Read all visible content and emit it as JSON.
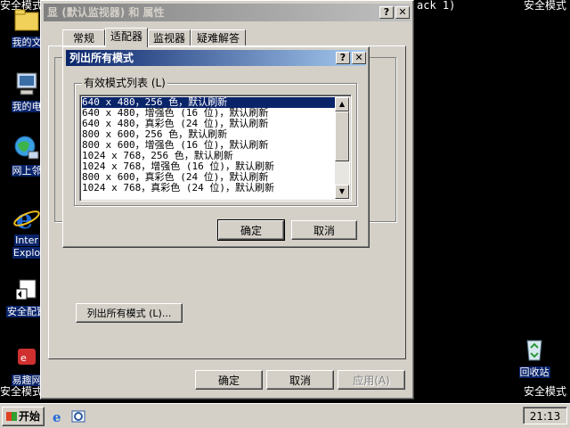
{
  "desktop": {
    "safe_mode_label": "安全模式",
    "service_pack_text": "ack 1)",
    "icons": [
      {
        "label": "我的文"
      },
      {
        "label": "我的电"
      },
      {
        "label": "网上邻"
      },
      {
        "label": "Inter",
        "label2": "Explo"
      },
      {
        "label": "安全配置"
      },
      {
        "label": "易趣网"
      },
      {
        "label": "回收站"
      }
    ]
  },
  "props_window": {
    "title": "(默认监视器) 和   属性",
    "title_prefix": "显",
    "help_button": "?",
    "close_button": "✕",
    "tabs": [
      "常规",
      "适配器",
      "监视器",
      "疑难解答"
    ],
    "active_tab": "适配器",
    "list_all_modes_button": "列出所有模式 (L)...",
    "ok_button": "确定",
    "cancel_button": "取消",
    "apply_button": "应用(A)"
  },
  "list_dialog": {
    "title": "列出所有模式",
    "help_button": "?",
    "close_button": "✕",
    "group_label": "有效模式列表 (L)",
    "modes": [
      "640 x 480，256 色，默认刷新",
      "640 x 480，增强色 (16 位)，默认刷新",
      "640 x 480，真彩色 (24 位)，默认刷新",
      "800 x 600，256 色，默认刷新",
      "800 x 600，增强色 (16 位)，默认刷新",
      "1024 x 768，256 色，默认刷新",
      "1024 x 768，增强色 (16 位)，默认刷新",
      "800 x 600，真彩色 (24 位)，默认刷新",
      "1024 x 768，真彩色 (24 位)，默认刷新"
    ],
    "selected_index": 0,
    "ok_button": "确定",
    "cancel_button": "取消"
  },
  "taskbar": {
    "start_label": "开始",
    "clock": "21:13"
  }
}
